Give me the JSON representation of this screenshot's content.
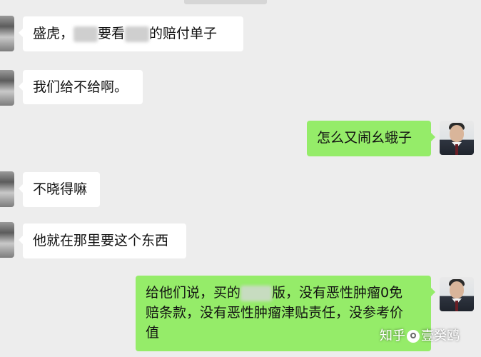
{
  "messages": [
    {
      "side": "left",
      "parts": [
        "盛虎，",
        "要看",
        "的赔付单子"
      ]
    },
    {
      "side": "left",
      "text": "我们给不给啊。"
    },
    {
      "side": "right",
      "text": "怎么又闹幺蛾子"
    },
    {
      "side": "left",
      "text": "不晓得嘛"
    },
    {
      "side": "left",
      "text": "他就在那里要这个东西"
    },
    {
      "side": "right",
      "parts": [
        "给他们说，买的",
        "版，没有恶性肿瘤0免",
        "赔条款，没有恶性肿瘤津贴责任，没参考价",
        "值"
      ]
    }
  ],
  "watermark": {
    "text1": "知乎",
    "text2": "壹癸鸥"
  },
  "colors": {
    "background": "#ededed",
    "incoming": "#ffffff",
    "outgoing": "#95ec69"
  }
}
